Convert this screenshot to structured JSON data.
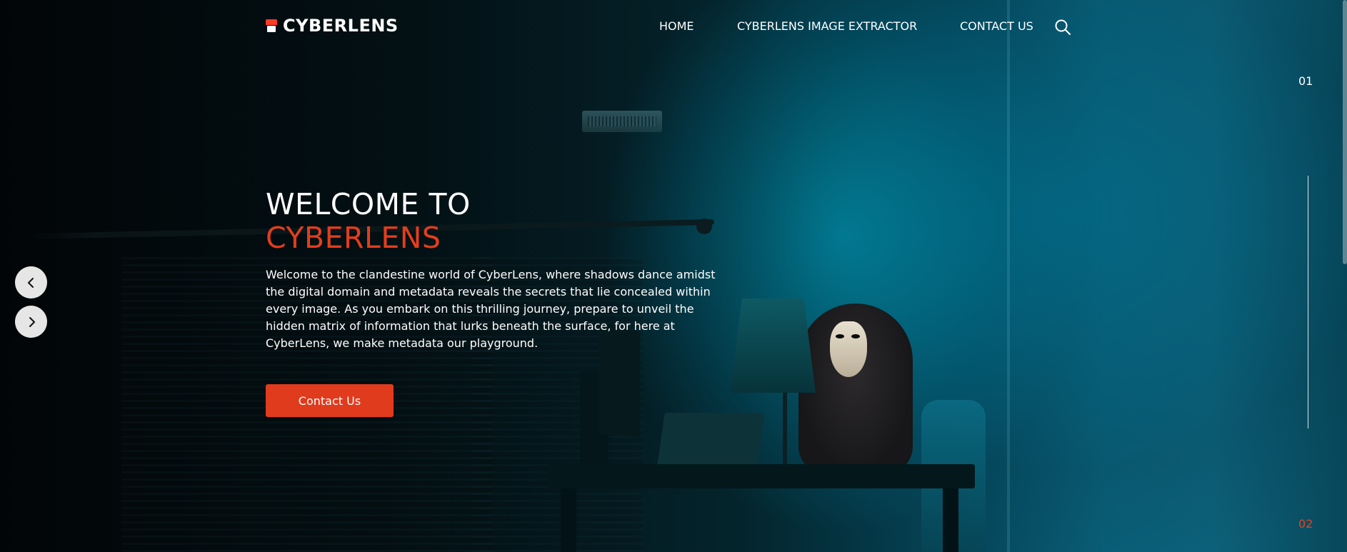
{
  "brand": {
    "name": "CYBERLENS",
    "icon": "camera-logo-icon"
  },
  "nav": {
    "items": [
      {
        "label": "HOME"
      },
      {
        "label": "CYBERLENS IMAGE EXTRACTOR"
      },
      {
        "label": "CONTACT US"
      }
    ],
    "search_icon": "search-icon"
  },
  "hero": {
    "title_line1": "WELCOME TO",
    "title_line2": "CYBERLENS",
    "description": "Welcome to the clandestine world of CyberLens, where shadows dance amidst the digital domain and metadata reveals the secrets that lie concealed within every image. As you embark on this thrilling journey, prepare to unveil the hidden matrix of information that lurks beneath the surface, for here at CyberLens, we make metadata our playground.",
    "cta_label": "Contact Us"
  },
  "slider": {
    "current": "01",
    "next": "02",
    "prev_icon": "chevron-left-icon",
    "next_icon": "chevron-right-icon"
  },
  "colors": {
    "accent": "#e03b1d",
    "text": "#ffffff",
    "background": "#02090c"
  }
}
